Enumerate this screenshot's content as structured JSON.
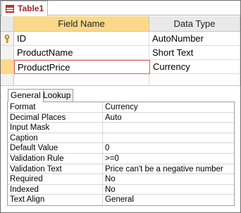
{
  "tab": {
    "label": "Table1",
    "icon": "table-icon"
  },
  "grid": {
    "columns": {
      "field_name": "Field Name",
      "data_type": "Data Type"
    },
    "rows": [
      {
        "field": "ID",
        "type": "AutoNumber",
        "primary_key": true
      },
      {
        "field": "ProductName",
        "type": "Short Text",
        "primary_key": false
      },
      {
        "field": "ProductPrice",
        "type": "Currency",
        "primary_key": false,
        "current": true
      }
    ]
  },
  "properties": {
    "tabs": [
      {
        "label": "General",
        "active": true
      },
      {
        "label": "Lookup",
        "active": false
      }
    ],
    "rows": [
      {
        "name": "Format",
        "value": "Currency"
      },
      {
        "name": "Decimal Places",
        "value": "Auto"
      },
      {
        "name": "Input Mask",
        "value": ""
      },
      {
        "name": "Caption",
        "value": ""
      },
      {
        "name": "Default Value",
        "value": "0"
      },
      {
        "name": "Validation Rule",
        "value": ">=0"
      },
      {
        "name": "Validation Text",
        "value": "Price can't be a negative number"
      },
      {
        "name": "Required",
        "value": "No"
      },
      {
        "name": "Indexed",
        "value": "No"
      },
      {
        "name": "Text Align",
        "value": "General"
      }
    ]
  },
  "colors": {
    "selected_header": "#fbd98a",
    "tab_text": "#a4262c",
    "focus_border": "#e05a5a"
  }
}
